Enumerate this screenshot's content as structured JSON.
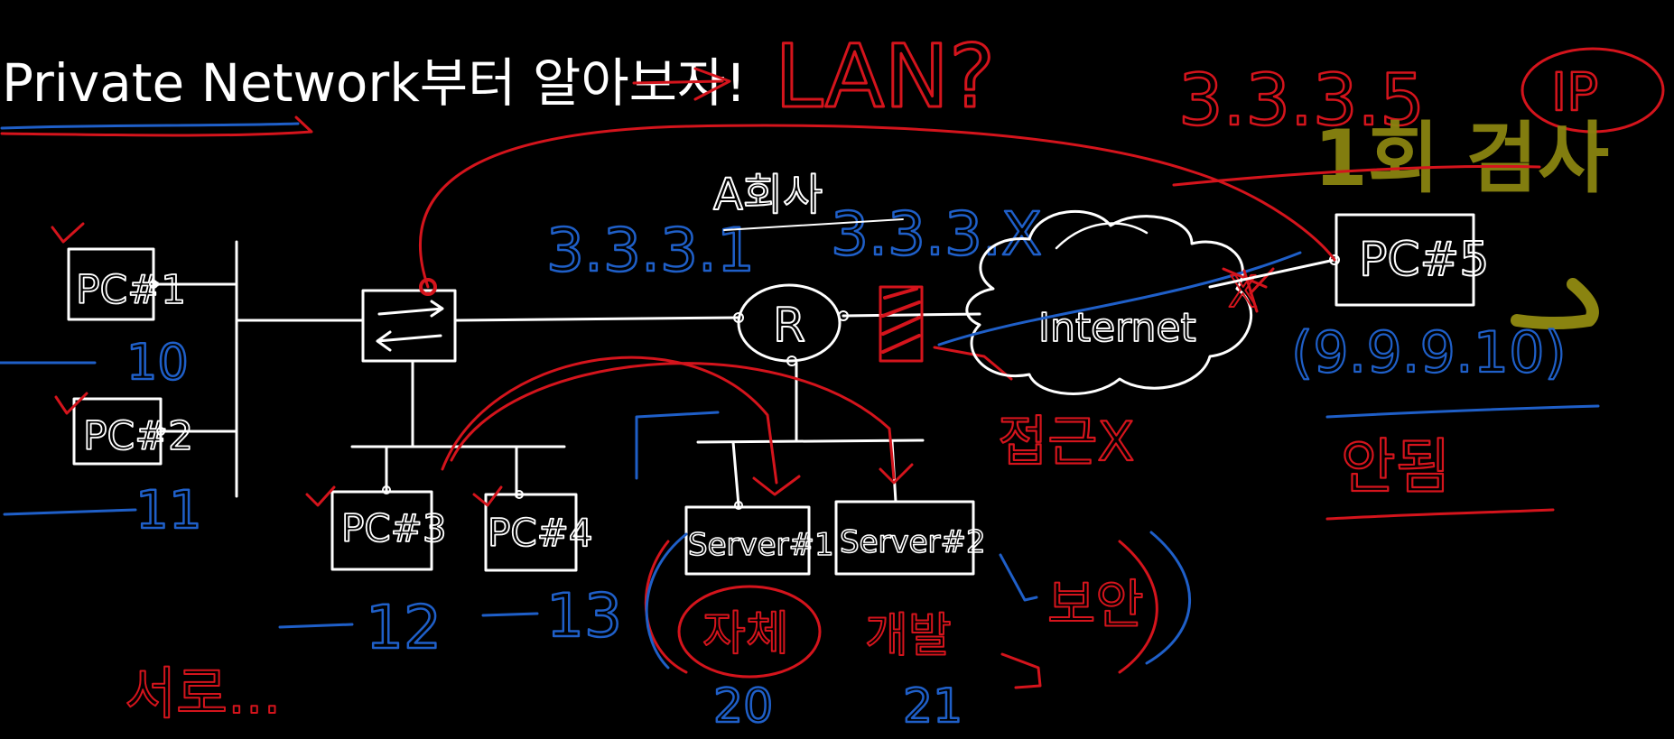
{
  "colors": {
    "background": "#000000",
    "ink_white": "#ffffff",
    "ink_red": "#d4141c",
    "ink_blue": "#1f5fc8",
    "ink_olive": "#8a8410"
  },
  "title": {
    "text": "Private Network부터 알아보자!",
    "arrow_target": "LAN?"
  },
  "top_right": {
    "ip_text": "3.3.3.5",
    "circled_label": "IP",
    "olive_note": "1회 검사"
  },
  "isp": {
    "label": "A회사",
    "subnet_left": "3.3.3.1",
    "subnet_right": "3.3.3.X"
  },
  "devices": {
    "pc1": "PC#1",
    "pc2": "PC#2",
    "pc3": "PC#3",
    "pc4": "PC#4",
    "pc5": "PC#5",
    "router": "R",
    "server1": "Server#1",
    "server2": "Server#2",
    "internet": "Internet"
  },
  "addresses": {
    "pc1": "10",
    "pc2": "11",
    "pc3": "12",
    "pc4": "13",
    "server1": "20",
    "server2": "21",
    "pc5": "(9.9.9.10)"
  },
  "annotations": {
    "blocked_access": "접근X",
    "pc5_status": "안됨",
    "server_note_1": "자체",
    "server_note_2": "개발",
    "server_note_3": "보안",
    "bottom_left": "서로...",
    "x_mark": "X"
  }
}
